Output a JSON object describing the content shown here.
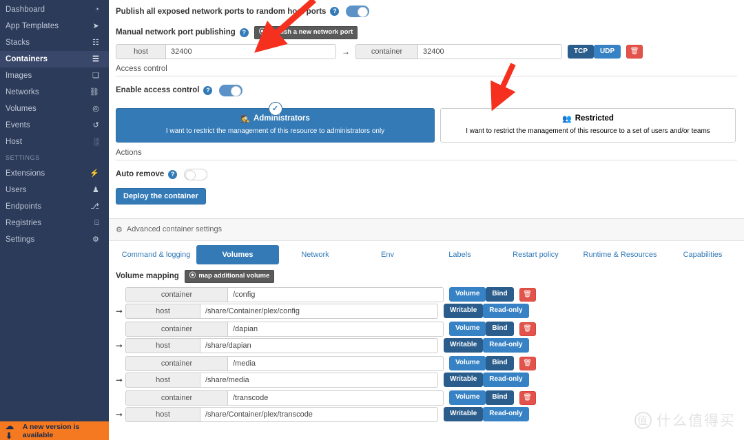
{
  "sidebar": {
    "items": [
      {
        "label": "Dashboard",
        "icon": "gauge-icon",
        "active": false
      },
      {
        "label": "App Templates",
        "icon": "rocket-icon",
        "active": false
      },
      {
        "label": "Stacks",
        "icon": "list-icon",
        "active": false
      },
      {
        "label": "Containers",
        "icon": "server-icon",
        "active": true
      },
      {
        "label": "Images",
        "icon": "layers-icon",
        "active": false
      },
      {
        "label": "Networks",
        "icon": "sitemap-icon",
        "active": false
      },
      {
        "label": "Volumes",
        "icon": "hdd-icon",
        "active": false
      },
      {
        "label": "Events",
        "icon": "history-icon",
        "active": false
      },
      {
        "label": "Host",
        "icon": "grid-icon",
        "active": false
      }
    ],
    "section_label": "SETTINGS",
    "settings_items": [
      {
        "label": "Extensions",
        "icon": "bolt-icon"
      },
      {
        "label": "Users",
        "icon": "users-icon"
      },
      {
        "label": "Endpoints",
        "icon": "plug-icon"
      },
      {
        "label": "Registries",
        "icon": "database-icon"
      },
      {
        "label": "Settings",
        "icon": "gears-icon"
      }
    ],
    "version_notice": "A new version is available",
    "version_icon": "cloud-download-icon",
    "accent": "#f47920",
    "background": "#2c3b5a"
  },
  "ports": {
    "publish_all_label": "Publish all exposed network ports to random host ports",
    "publish_all_on": true,
    "manual_label": "Manual network port publishing",
    "add_port_button": "publish a new network port",
    "rows": [
      {
        "host_addon": "host",
        "host_value": "32400",
        "container_addon": "container",
        "container_value": "32400",
        "protocols": [
          {
            "label": "TCP",
            "selected": true
          },
          {
            "label": "UDP",
            "selected": false
          }
        ],
        "delete_icon": "trash-icon"
      }
    ]
  },
  "access_control": {
    "section_title": "Access control",
    "enable_label": "Enable access control",
    "enable_on": true,
    "cards": [
      {
        "title": "Administrators",
        "icon": "user-secret-icon",
        "description": "I want to restrict the management of this resource to administrators only",
        "selected": true,
        "check_icon": "check-icon"
      },
      {
        "title": "Restricted",
        "icon": "users-icon",
        "description": "I want to restrict the management of this resource to a set of users and/or teams",
        "selected": false
      }
    ]
  },
  "actions": {
    "section_title": "Actions",
    "auto_remove_label": "Auto remove",
    "auto_remove_on": false,
    "deploy_button": "Deploy the container"
  },
  "advanced": {
    "header": "Advanced container settings",
    "header_icon": "gear-icon",
    "tabs": [
      {
        "label": "Command & logging",
        "active": false
      },
      {
        "label": "Volumes",
        "active": true
      },
      {
        "label": "Network",
        "active": false
      },
      {
        "label": "Env",
        "active": false
      },
      {
        "label": "Labels",
        "active": false
      },
      {
        "label": "Restart policy",
        "active": false
      },
      {
        "label": "Runtime & Resources",
        "active": false
      },
      {
        "label": "Capabilities",
        "active": false
      }
    ]
  },
  "volumes": {
    "title": "Volume mapping",
    "add_button": "map additional volume",
    "arrow_glyph": "➞",
    "mappings": [
      {
        "container_addon": "container",
        "container_path": "/config",
        "host_addon": "host",
        "host_path": "/share/Container/plex/config",
        "type_options": [
          {
            "label": "Volume",
            "selected": false
          },
          {
            "label": "Bind",
            "selected": true
          }
        ],
        "access_options": [
          {
            "label": "Writable",
            "selected": true
          },
          {
            "label": "Read-only",
            "selected": false
          }
        ],
        "delete_icon": "trash-icon"
      },
      {
        "container_addon": "container",
        "container_path": "/dapian",
        "host_addon": "host",
        "host_path": "/share/dapian",
        "type_options": [
          {
            "label": "Volume",
            "selected": false
          },
          {
            "label": "Bind",
            "selected": true
          }
        ],
        "access_options": [
          {
            "label": "Writable",
            "selected": true
          },
          {
            "label": "Read-only",
            "selected": false
          }
        ],
        "delete_icon": "trash-icon"
      },
      {
        "container_addon": "container",
        "container_path": "/media",
        "host_addon": "host",
        "host_path": "/share/media",
        "type_options": [
          {
            "label": "Volume",
            "selected": false
          },
          {
            "label": "Bind",
            "selected": true
          }
        ],
        "access_options": [
          {
            "label": "Writable",
            "selected": true
          },
          {
            "label": "Read-only",
            "selected": false
          }
        ],
        "delete_icon": "trash-icon"
      },
      {
        "container_addon": "container",
        "container_path": "/transcode",
        "host_addon": "host",
        "host_path": "/share/Container/plex/transcode",
        "type_options": [
          {
            "label": "Volume",
            "selected": false
          },
          {
            "label": "Bind",
            "selected": true
          }
        ],
        "access_options": [
          {
            "label": "Writable",
            "selected": true
          },
          {
            "label": "Read-only",
            "selected": false
          }
        ],
        "delete_icon": "trash-icon"
      }
    ]
  },
  "watermark": {
    "badge": "值",
    "text": "什么值得买"
  },
  "colors": {
    "primary_blue": "#337ab7",
    "dark_blue": "#2b5d8c",
    "light_blue": "#3782c4",
    "danger_red": "#e2544b",
    "annotation_red": "#f5301e",
    "sidebar_bg": "#2c3b5a",
    "notice_orange": "#f47920"
  }
}
